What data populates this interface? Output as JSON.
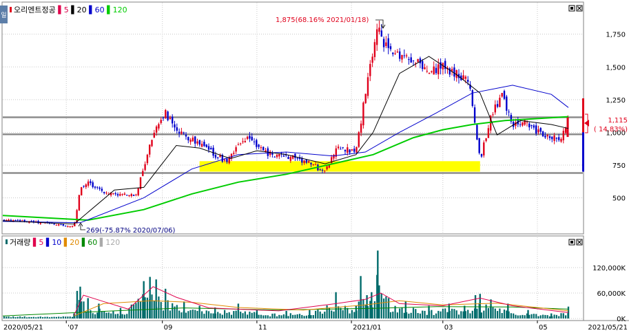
{
  "side_tab": "일",
  "price_legend": {
    "name": "오리엔트정공",
    "marks": [
      {
        "label": "5",
        "color": "#e0004c"
      },
      {
        "label": "20",
        "color": "#000000"
      },
      {
        "label": "60",
        "color": "#0000cc"
      },
      {
        "label": "120",
        "color": "#00cc00"
      }
    ]
  },
  "volume_legend": {
    "name": "거래량",
    "marks": [
      {
        "label": "5",
        "color": "#e0004c"
      },
      {
        "label": "10",
        "color": "#0000cc"
      },
      {
        "label": "20",
        "color": "#e08a00"
      },
      {
        "label": "60",
        "color": "#008800"
      },
      {
        "label": "120",
        "color": "#aaaaaa"
      }
    ]
  },
  "annotations": {
    "high": "1,875(68.16% 2021/01/18)",
    "low": "269(-75.87% 2020/07/06)"
  },
  "current_price": {
    "value": "1,115",
    "change": "( 14.83%)"
  },
  "x_axis": {
    "start_date": "2020/05/21",
    "end_date": "2021/05/21",
    "tick_labels": [
      "'07",
      "09",
      "11",
      "2021/01",
      "03",
      "05"
    ]
  },
  "colors": {
    "up": "#e0001b",
    "down": "#0000cc",
    "ma5": "#e0004c",
    "ma20": "#000000",
    "ma60": "#0000cc",
    "ma120": "#00cc00",
    "support_band": "#ffff00",
    "volume_bar": "#006b6b",
    "grid": "#c8c8c8"
  },
  "chart_data": [
    {
      "type": "candlestick",
      "title": "오리엔트정공",
      "y_ticks": [
        500,
        750,
        1000,
        1250,
        1500,
        1750
      ],
      "y_tick_labels": [
        "500",
        "750",
        "1,000",
        "1,250",
        "1,500",
        "1,750"
      ],
      "ylim": [
        230,
        1990
      ],
      "horizontal_lines": [
        1115,
        985,
        690
      ],
      "support_band": {
        "from_date": "2020/09/25",
        "to_date": "2021/03/25",
        "low": 700,
        "high": 780
      },
      "high_point": {
        "date": "2021/01/18",
        "value": 1875
      },
      "low_point": {
        "date": "2020/07/06",
        "value": 269
      },
      "price_series": [
        [
          "2020/05/21",
          330
        ],
        [
          "2020/06/05",
          320
        ],
        [
          "2020/06/20",
          305
        ],
        [
          "2020/07/06",
          280
        ],
        [
          "2020/07/10",
          560
        ],
        [
          "2020/07/15",
          620
        ],
        [
          "2020/07/25",
          545
        ],
        [
          "2020/08/05",
          525
        ],
        [
          "2020/08/15",
          520
        ],
        [
          "2020/08/22",
          820
        ],
        [
          "2020/08/28",
          1060
        ],
        [
          "2020/09/03",
          1150
        ],
        [
          "2020/09/10",
          1000
        ],
        [
          "2020/09/20",
          950
        ],
        [
          "2020/09/28",
          880
        ],
        [
          "2020/10/05",
          830
        ],
        [
          "2020/10/12",
          780
        ],
        [
          "2020/10/20",
          900
        ],
        [
          "2020/10/28",
          960
        ],
        [
          "2020/11/05",
          850
        ],
        [
          "2020/11/15",
          820
        ],
        [
          "2020/11/25",
          810
        ],
        [
          "2020/12/05",
          760
        ],
        [
          "2020/12/15",
          700
        ],
        [
          "2020/12/22",
          880
        ],
        [
          "2021/01/04",
          860
        ],
        [
          "2021/01/08",
          1150
        ],
        [
          "2021/01/13",
          1500
        ],
        [
          "2021/01/18",
          1780
        ],
        [
          "2021/01/25",
          1620
        ],
        [
          "2021/02/01",
          1600
        ],
        [
          "2021/02/10",
          1560
        ],
        [
          "2021/02/20",
          1450
        ],
        [
          "2021/03/01",
          1500
        ],
        [
          "2021/03/10",
          1440
        ],
        [
          "2021/03/18",
          1380
        ],
        [
          "2021/03/25",
          790
        ],
        [
          "2021/04/01",
          1110
        ],
        [
          "2021/04/08",
          1300
        ],
        [
          "2021/04/15",
          1050
        ],
        [
          "2021/04/22",
          1080
        ],
        [
          "2021/05/01",
          1000
        ],
        [
          "2021/05/10",
          970
        ],
        [
          "2021/05/17",
          960
        ],
        [
          "2021/05/21",
          1115
        ]
      ],
      "ma20": [
        [
          "2020/05/21",
          325
        ],
        [
          "2020/07/06",
          300
        ],
        [
          "2020/08/01",
          560
        ],
        [
          "2020/08/20",
          580
        ],
        [
          "2020/09/10",
          900
        ],
        [
          "2020/09/25",
          880
        ],
        [
          "2020/10/15",
          800
        ],
        [
          "2020/11/01",
          860
        ],
        [
          "2020/11/20",
          830
        ],
        [
          "2020/12/15",
          760
        ],
        [
          "2021/01/04",
          830
        ],
        [
          "2021/01/15",
          1000
        ],
        [
          "2021/02/01",
          1450
        ],
        [
          "2021/02/20",
          1580
        ],
        [
          "2021/03/10",
          1440
        ],
        [
          "2021/03/25",
          1300
        ],
        [
          "2021/04/05",
          980
        ],
        [
          "2021/04/20",
          1090
        ],
        [
          "2021/05/10",
          1060
        ],
        [
          "2021/05/21",
          1030
        ]
      ],
      "ma60": [
        [
          "2020/05/21",
          320
        ],
        [
          "2020/07/10",
          310
        ],
        [
          "2020/08/20",
          500
        ],
        [
          "2020/09/20",
          720
        ],
        [
          "2020/10/20",
          830
        ],
        [
          "2020/11/20",
          850
        ],
        [
          "2020/12/20",
          820
        ],
        [
          "2021/01/10",
          850
        ],
        [
          "2021/02/01",
          1000
        ],
        [
          "2021/02/25",
          1150
        ],
        [
          "2021/03/20",
          1300
        ],
        [
          "2021/04/15",
          1360
        ],
        [
          "2021/05/10",
          1290
        ],
        [
          "2021/05/21",
          1190
        ]
      ],
      "ma120": [
        [
          "2020/05/21",
          365
        ],
        [
          "2020/07/15",
          330
        ],
        [
          "2020/08/20",
          410
        ],
        [
          "2020/09/20",
          530
        ],
        [
          "2020/10/20",
          620
        ],
        [
          "2020/11/20",
          680
        ],
        [
          "2020/12/20",
          760
        ],
        [
          "2021/01/15",
          830
        ],
        [
          "2021/02/10",
          960
        ],
        [
          "2021/03/01",
          1020
        ],
        [
          "2021/03/20",
          1060
        ],
        [
          "2021/04/10",
          1090
        ],
        [
          "2021/05/21",
          1120
        ]
      ]
    },
    {
      "type": "bar",
      "title": "거래량",
      "y_ticks": [
        0,
        60000,
        120000
      ],
      "y_tick_labels": [
        "0K",
        "60,000K",
        "120,000K"
      ],
      "ylim": [
        0,
        175000
      ],
      "volume_series": [
        [
          "2020/07/06",
          12000
        ],
        [
          "2020/07/08",
          65000
        ],
        [
          "2020/07/10",
          75000
        ],
        [
          "2020/07/15",
          48000
        ],
        [
          "2020/07/22",
          35000
        ],
        [
          "2020/08/05",
          25000
        ],
        [
          "2020/08/20",
          88000
        ],
        [
          "2020/08/24",
          98000
        ],
        [
          "2020/08/28",
          92000
        ],
        [
          "2020/09/03",
          70000
        ],
        [
          "2020/09/15",
          40000
        ],
        [
          "2020/09/25",
          30000
        ],
        [
          "2020/10/05",
          26000
        ],
        [
          "2020/10/20",
          35000
        ],
        [
          "2020/11/01",
          20000
        ],
        [
          "2020/11/20",
          18000
        ],
        [
          "2020/12/05",
          20000
        ],
        [
          "2020/12/22",
          62000
        ],
        [
          "2021/01/04",
          30000
        ],
        [
          "2021/01/07",
          100000
        ],
        [
          "2021/01/11",
          55000
        ],
        [
          "2021/01/14",
          62000
        ],
        [
          "2021/01/18",
          160000
        ],
        [
          "2021/01/25",
          48000
        ],
        [
          "2021/02/05",
          40000
        ],
        [
          "2021/02/20",
          30000
        ],
        [
          "2021/03/05",
          35000
        ],
        [
          "2021/03/15",
          30000
        ],
        [
          "2021/03/22",
          55000
        ],
        [
          "2021/03/25",
          58000
        ],
        [
          "2021/04/01",
          45000
        ],
        [
          "2021/04/12",
          35000
        ],
        [
          "2021/04/25",
          20000
        ],
        [
          "2021/05/10",
          12000
        ],
        [
          "2021/05/21",
          28000
        ]
      ],
      "vol_ma5": [
        [
          "2020/07/06",
          8000
        ],
        [
          "2020/07/12",
          55000
        ],
        [
          "2020/07/25",
          40000
        ],
        [
          "2020/08/10",
          22000
        ],
        [
          "2020/08/26",
          75000
        ],
        [
          "2020/09/10",
          50000
        ],
        [
          "2020/10/01",
          25000
        ],
        [
          "2020/11/15",
          18000
        ],
        [
          "2020/12/22",
          35000
        ],
        [
          "2021/01/10",
          45000
        ],
        [
          "2021/01/20",
          60000
        ],
        [
          "2021/02/01",
          35000
        ],
        [
          "2021/03/01",
          30000
        ],
        [
          "2021/03/25",
          48000
        ],
        [
          "2021/04/15",
          30000
        ],
        [
          "2021/05/21",
          14000
        ]
      ],
      "vol_ma20": [
        [
          "2020/07/06",
          6000
        ],
        [
          "2020/07/25",
          35000
        ],
        [
          "2020/08/25",
          42000
        ],
        [
          "2020/09/20",
          38000
        ],
        [
          "2020/10/20",
          26000
        ],
        [
          "2020/12/01",
          20000
        ],
        [
          "2021/01/10",
          32000
        ],
        [
          "2021/02/01",
          42000
        ],
        [
          "2021/03/01",
          32000
        ],
        [
          "2021/04/05",
          36000
        ],
        [
          "2021/05/21",
          18000
        ]
      ],
      "vol_ma60": [
        [
          "2020/05/21",
          6000
        ],
        [
          "2020/08/01",
          18000
        ],
        [
          "2020/09/15",
          25000
        ],
        [
          "2020/11/15",
          20000
        ],
        [
          "2021/01/15",
          24000
        ],
        [
          "2021/02/25",
          28000
        ],
        [
          "2021/04/15",
          27000
        ],
        [
          "2021/05/21",
          22000
        ]
      ]
    }
  ]
}
